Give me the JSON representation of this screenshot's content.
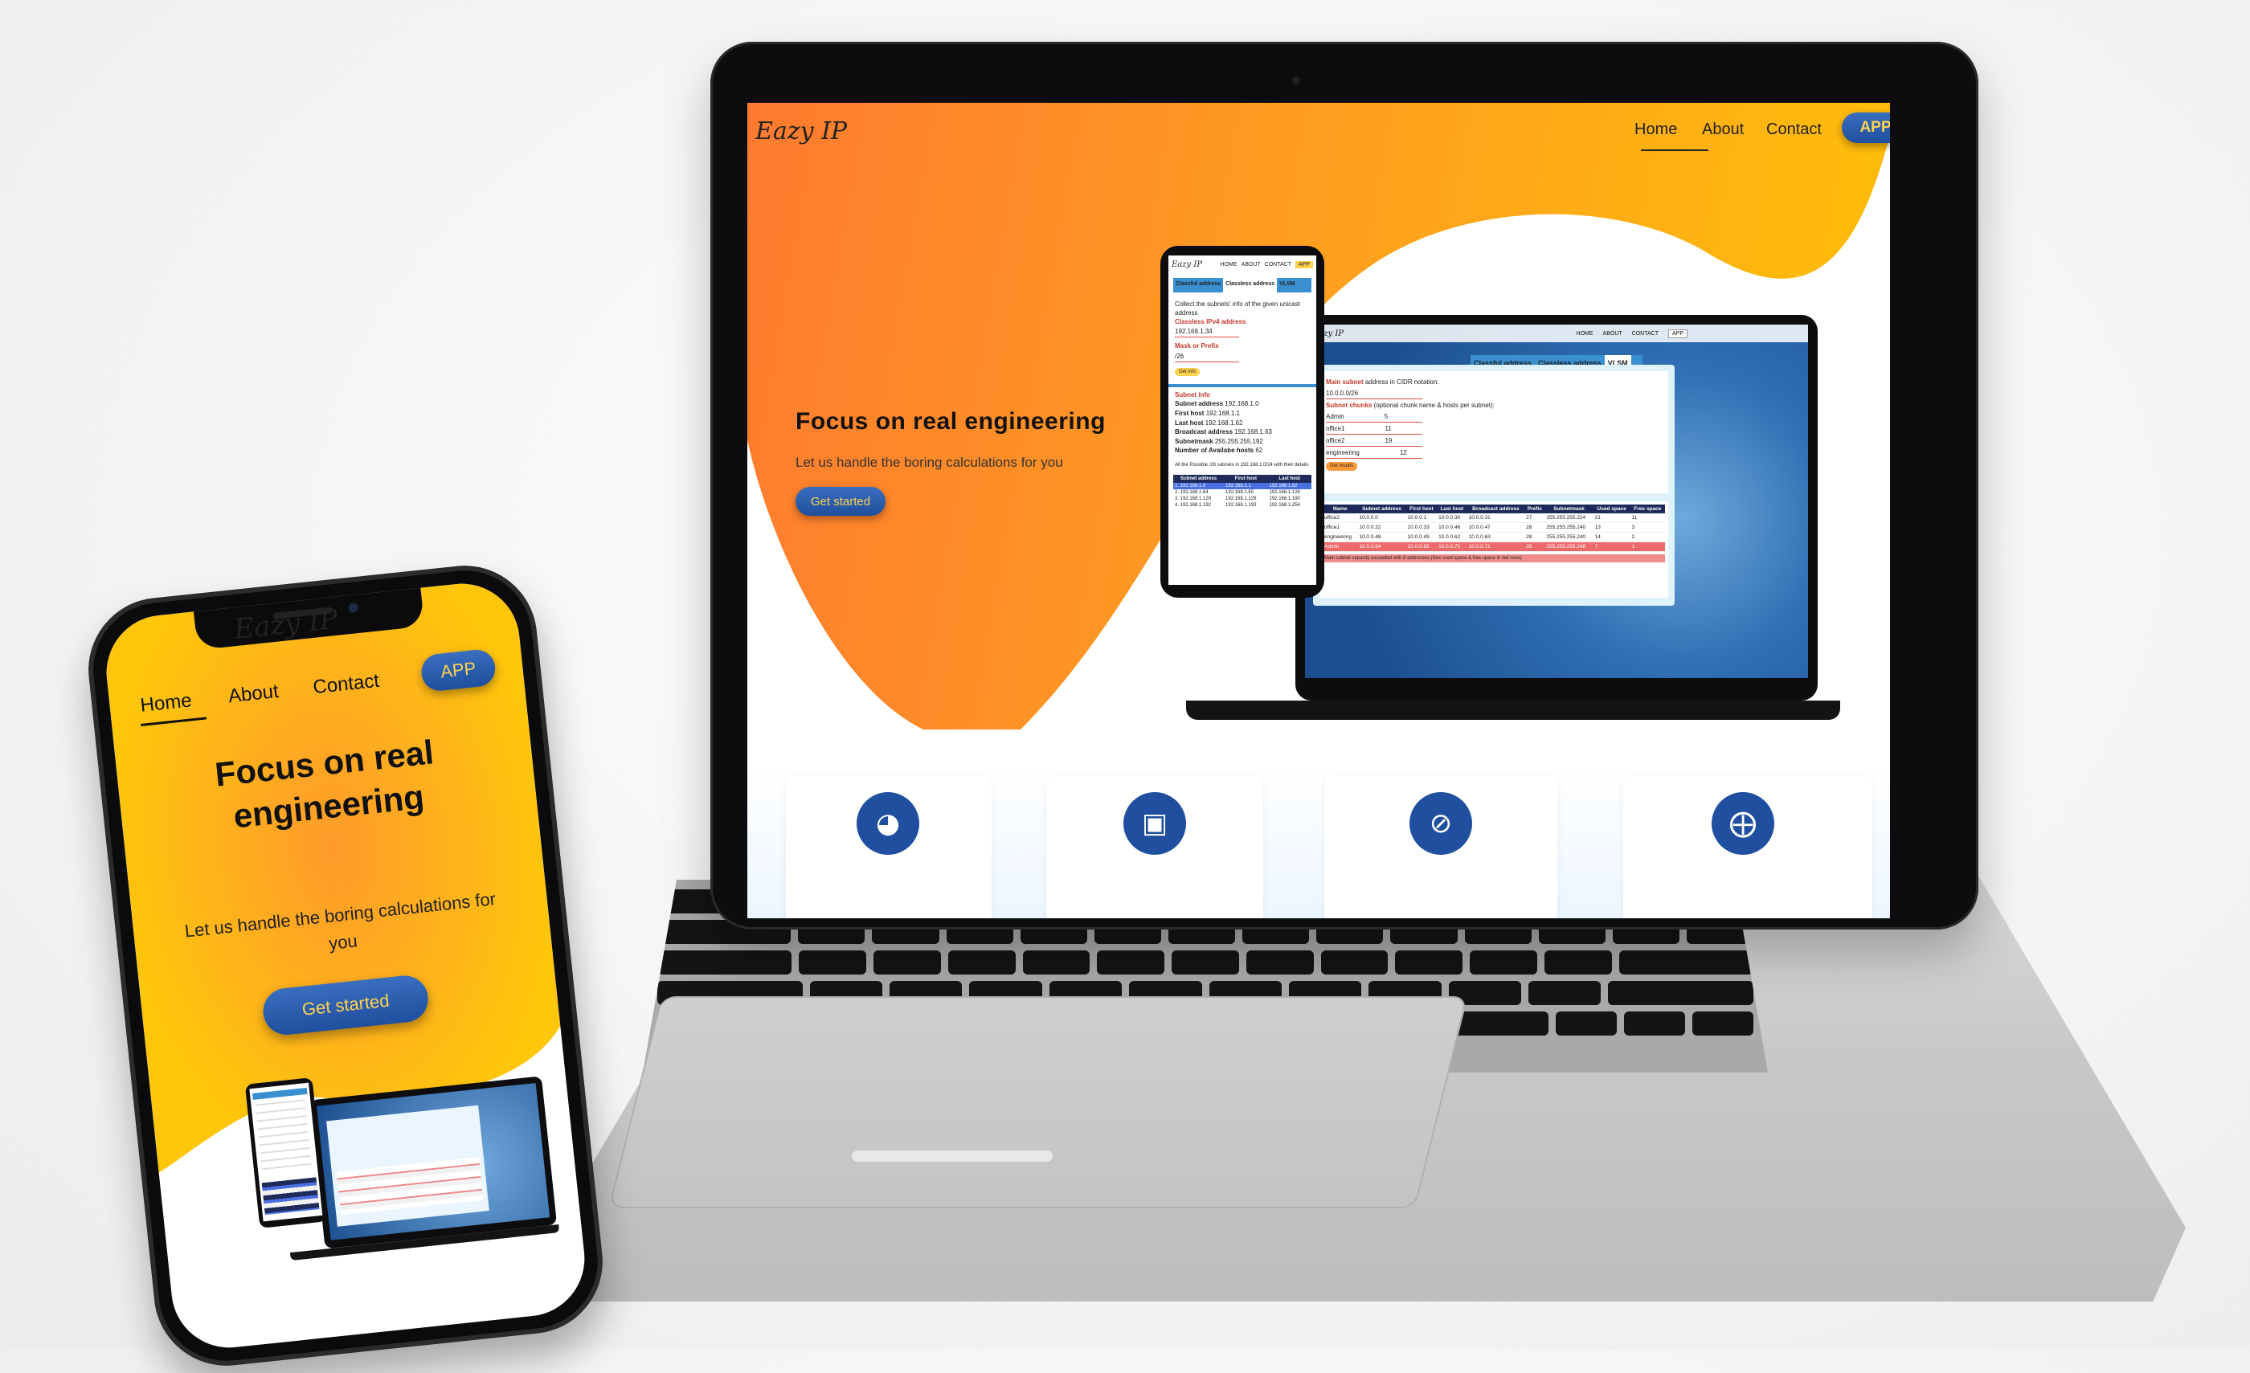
{
  "site": {
    "logo": "Eazy IP",
    "nav": {
      "home": "Home",
      "about": "About",
      "contact": "Contact",
      "app": "APP"
    },
    "hero": {
      "title": "Focus on real engineering",
      "subtitle": "Let us handle the boring calculations for you",
      "cta": "Get started"
    },
    "feature_icons": [
      "speedometer-icon",
      "money-icon",
      "no-wifi-icon",
      "layers-plus-icon"
    ]
  },
  "mini_phone": {
    "nav": [
      "HOME",
      "ABOUT",
      "CONTACT",
      "APP"
    ],
    "tabs": [
      "Classful address",
      "Classless address",
      "VLSM"
    ],
    "intro": "Collect the subnets' info of the given unicast address",
    "ip_label": "Classless IPv4 address",
    "ip_value": "192.168.1.34",
    "mask_label": "Mask or Prefix",
    "mask_value": "/26",
    "button": "Get info",
    "info_title": "Subnet info",
    "info": [
      {
        "label": "Subnet address",
        "value": "192.168.1.0"
      },
      {
        "label": "First host",
        "value": "192.168.1.1"
      },
      {
        "label": "Last host",
        "value": "192.168.1.62"
      },
      {
        "label": "Broadcast address",
        "value": "192.168.1.63"
      },
      {
        "label": "Subnetmask",
        "value": "255.255.255.192"
      },
      {
        "label": "Number of Availabe hosts",
        "value": "62"
      }
    ],
    "table_caption": "All the Possible /26 subnets in 192.168.1.0/24 with their details",
    "table_headers": [
      "Subnet address",
      "First host",
      "Last host"
    ],
    "table_rows": [
      [
        "1. 192.168.1.0",
        "192.168.1.1",
        "192.168.1.62"
      ],
      [
        "2. 192.168.1.64",
        "192.168.1.65",
        "192.168.1.126"
      ],
      [
        "3. 192.168.1.128",
        "192.168.1.129",
        "192.168.1.190"
      ],
      [
        "4. 192.168.1.192",
        "192.168.1.193",
        "192.168.1.254"
      ]
    ]
  },
  "mini_laptop": {
    "nav": [
      "HOME",
      "ABOUT",
      "CONTACT",
      "APP"
    ],
    "tabs": [
      "Classful address",
      "Classless address",
      "VLSM"
    ],
    "main_label": "Main subnet",
    "main_label_rest": "address in CIDR notation:",
    "main_value": "10.0.0.0/26",
    "chunks_label": "Subnet chunks",
    "chunks_label_rest": "(optional chunk name & hosts per subnet):",
    "chunks": [
      {
        "name": "Admin",
        "hosts": "5"
      },
      {
        "name": "office1",
        "hosts": "11"
      },
      {
        "name": "office2",
        "hosts": "19"
      },
      {
        "name": "engineering",
        "hosts": "12"
      }
    ],
    "button": "Get results",
    "table_headers": [
      "Name",
      "Subnet address",
      "First host",
      "Last host",
      "Broadcast address",
      "Prefix",
      "Subnetmask",
      "Used space",
      "Free space"
    ],
    "table_rows": [
      [
        "office2",
        "10.0.0.0",
        "10.0.0.1",
        "10.0.0.30",
        "10.0.0.31",
        "27",
        "255.255.255.224",
        "21",
        "11"
      ],
      [
        "office1",
        "10.0.0.32",
        "10.0.0.33",
        "10.0.0.46",
        "10.0.0.47",
        "28",
        "255.255.255.240",
        "13",
        "3"
      ],
      [
        "engineering",
        "10.0.0.48",
        "10.0.0.49",
        "10.0.0.62",
        "10.0.0.63",
        "28",
        "255.255.255.240",
        "14",
        "2"
      ],
      [
        "Admin",
        "10.0.0.64",
        "10.0.0.65",
        "10.0.0.70",
        "10.0.0.71",
        "29",
        "255.255.255.248",
        "7",
        "1"
      ]
    ],
    "note": "Main subnet capacity exceeded with 8 addresses (See used space & free space in red rows)"
  },
  "colors": {
    "orange": "#ff7a30",
    "yellow": "#ffc107",
    "brand_blue": "#1f4f9e",
    "cta_text": "#ffd34e"
  }
}
